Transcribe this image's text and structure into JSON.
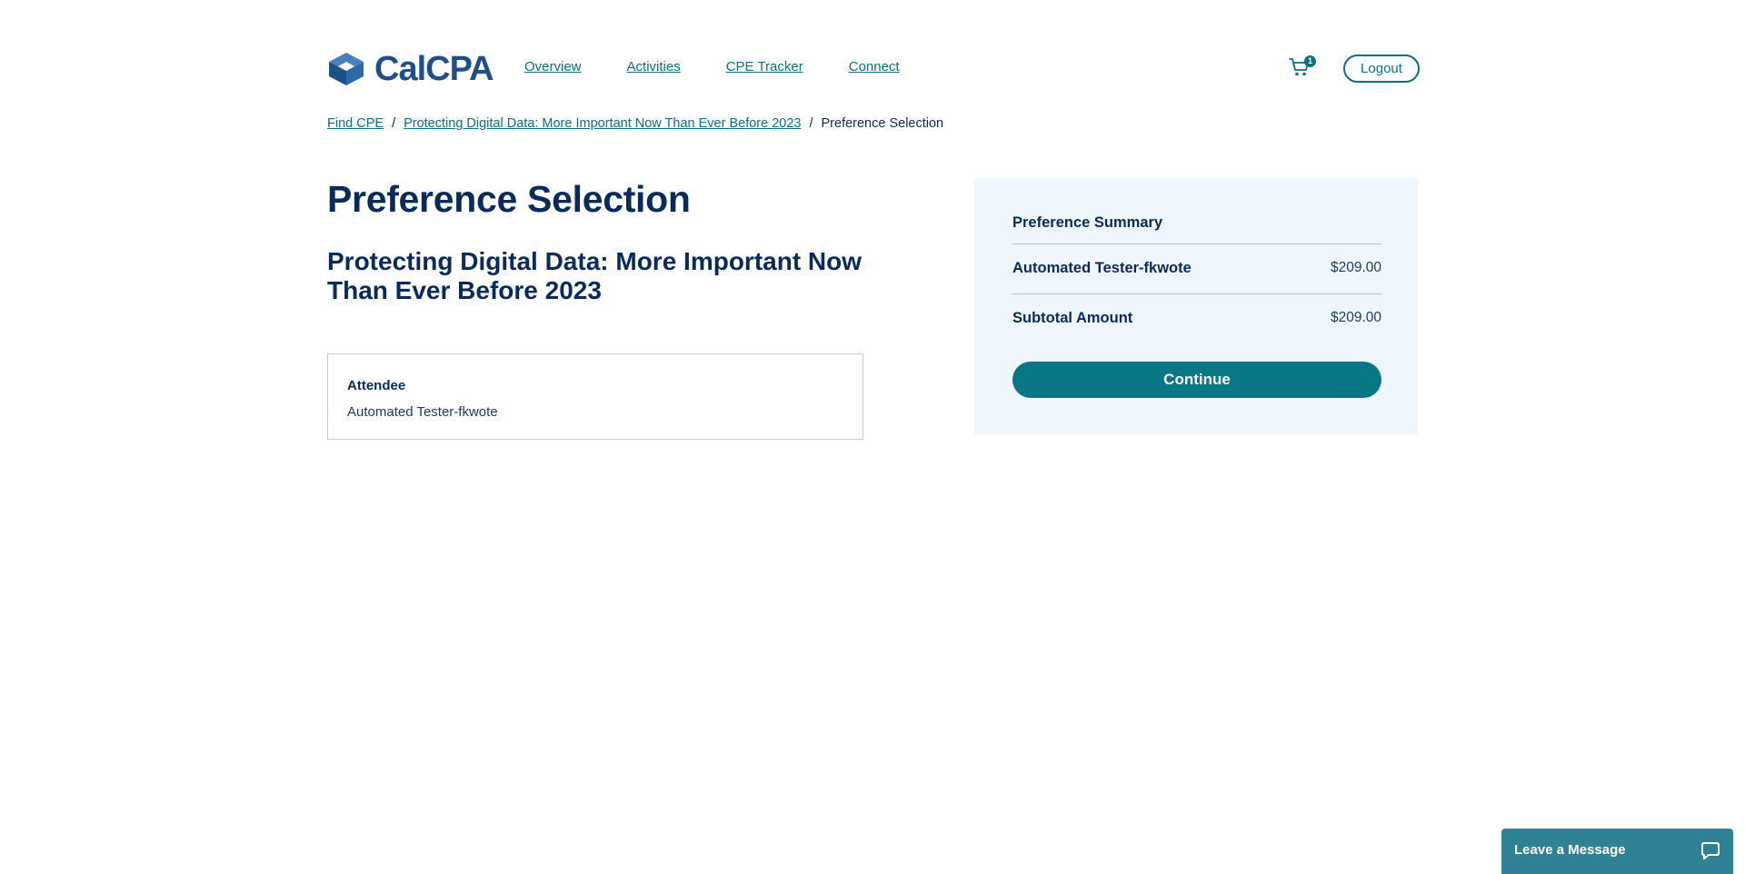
{
  "brand": {
    "name": "CalCPA",
    "accent": "#0d6f80",
    "navy": "#0a2a5c",
    "logo_blue": "#1d4f8a"
  },
  "nav": {
    "items": [
      "Overview",
      "Activities",
      "CPE Tracker",
      "Connect"
    ]
  },
  "cart": {
    "count": "1"
  },
  "header": {
    "logout_label": "Logout"
  },
  "breadcrumb": {
    "items": [
      "Find CPE",
      "Protecting Digital Data: More Important Now Than Ever Before 2023"
    ],
    "separator": "/",
    "current": "Preference Selection"
  },
  "main": {
    "title": "Preference Selection",
    "course_title": "Protecting Digital Data: More Important Now Than Ever Before 2023",
    "attendee": {
      "label": "Attendee",
      "name": "Automated Tester-fkwote"
    }
  },
  "summary": {
    "title": "Preference Summary",
    "line_item": {
      "label": "Automated Tester-fkwote",
      "amount": "$209.00"
    },
    "subtotal": {
      "label": "Subtotal Amount",
      "amount": "$209.00"
    },
    "continue_label": "Continue"
  },
  "chat": {
    "label": "Leave a Message"
  }
}
